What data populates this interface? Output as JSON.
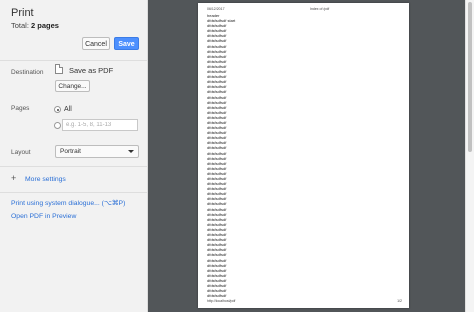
{
  "dialog": {
    "title": "Print",
    "total_label": "Total:",
    "total_value": "2 pages",
    "cancel_label": "Cancel",
    "save_label": "Save"
  },
  "destination": {
    "label": "Destination",
    "name": "Save as PDF",
    "change_label": "Change..."
  },
  "pages": {
    "label": "Pages",
    "all_label": "All",
    "custom_placeholder": "e.g. 1-5, 8, 11-13"
  },
  "layout": {
    "label": "Layout",
    "selected": "Portrait"
  },
  "more_settings": {
    "icon": "plus-icon",
    "label": "More settings"
  },
  "links": {
    "system_dialog": "Print using system dialogue... (⌥⌘P)",
    "open_preview": "Open PDF in Preview"
  },
  "preview_page": {
    "header_left": "06/12/2017",
    "header_center": "Index of /pdf",
    "footer_left": "http://localhost/pdf",
    "footer_right": "1/2",
    "lines": [
      "header",
      "dfdsfsdfsdf start",
      "dfdsfsdfsdf",
      "dfdsfsdfsdf",
      "dfdsfsdfsdf",
      "dfdsfsdfsdf",
      "dfdsfsdfsdf",
      "dfdsfsdfsdf",
      "dfdsfsdfsdf",
      "dfdsfsdfsdf",
      "dfdsfsdfsdf",
      "dfdsfsdfsdf",
      "dfdsfsdfsdf",
      "dfdsfsdfsdf",
      "dfdsfsdfsdf",
      "dfdsfsdfsdf",
      "dfdsfsdfsdf",
      "dfdsfsdfsdf",
      "dfdsfsdfsdf",
      "dfdsfsdfsdf",
      "dfdsfsdfsdf",
      "dfdsfsdfsdf",
      "dfdsfsdfsdf",
      "dfdsfsdfsdf",
      "dfdsfsdfsdf",
      "dfdsfsdfsdf",
      "dfdsfsdfsdf",
      "dfdsfsdfsdf",
      "dfdsfsdfsdf",
      "dfdsfsdfsdf",
      "dfdsfsdfsdf",
      "dfdsfsdfsdf",
      "dfdsfsdfsdf",
      "dfdsfsdfsdf",
      "dfdsfsdfsdf",
      "dfdsfsdfsdf",
      "dfdsfsdfsdf",
      "dfdsfsdfsdf",
      "dfdsfsdfsdf",
      "dfdsfsdfsdf",
      "dfdsfsdfsdf",
      "dfdsfsdfsdf",
      "dfdsfsdfsdf",
      "dfdsfsdfsdf",
      "dfdsfsdfsdf",
      "dfdsfsdfsdf",
      "dfdsfsdfsdf",
      "dfdsfsdfsdf",
      "dfdsfsdfsdf",
      "dfdsfsdfsdf",
      "dfdsfsdfsdf",
      "dfdsfsdfsdf",
      "dfdsfsdfsdf",
      "dfdsfsdfsdf",
      "dfdsfsdfsdf",
      "dfdsfsdfsdf"
    ]
  },
  "colors": {
    "accent": "#4d90fe",
    "link": "#2a6fd6",
    "preview_bg": "#525659"
  }
}
